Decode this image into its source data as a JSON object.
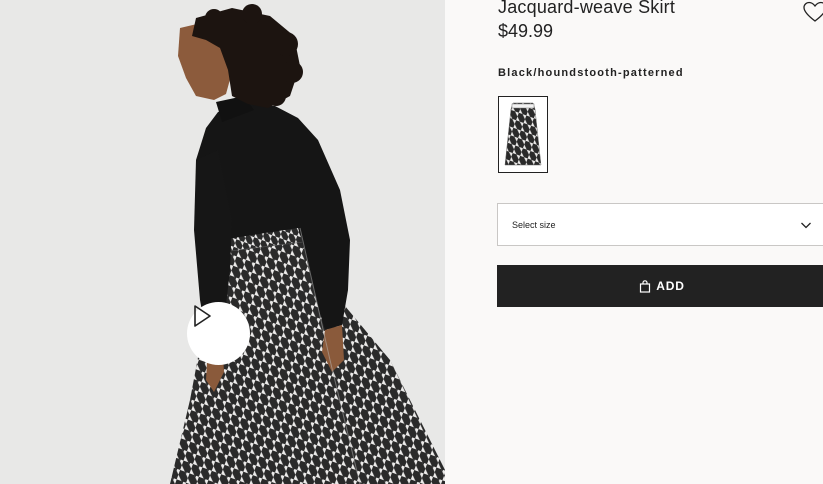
{
  "product": {
    "title": "Jacquard-weave Skirt",
    "price": "$49.99",
    "color_label": "Black/houndstooth-patterned"
  },
  "media": {
    "play_icon": "play-icon",
    "background_color": "#e8e8e7"
  },
  "actions": {
    "favorite_icon": "heart-icon",
    "size_select_label": "Select size",
    "size_select_icon": "chevron-down-icon",
    "add_label": "ADD",
    "add_icon": "shopping-bag-icon"
  },
  "colors": {
    "page_background": "#faf9f8",
    "button_background": "#222222",
    "button_text": "#ffffff",
    "border": "#c9c7c5"
  }
}
